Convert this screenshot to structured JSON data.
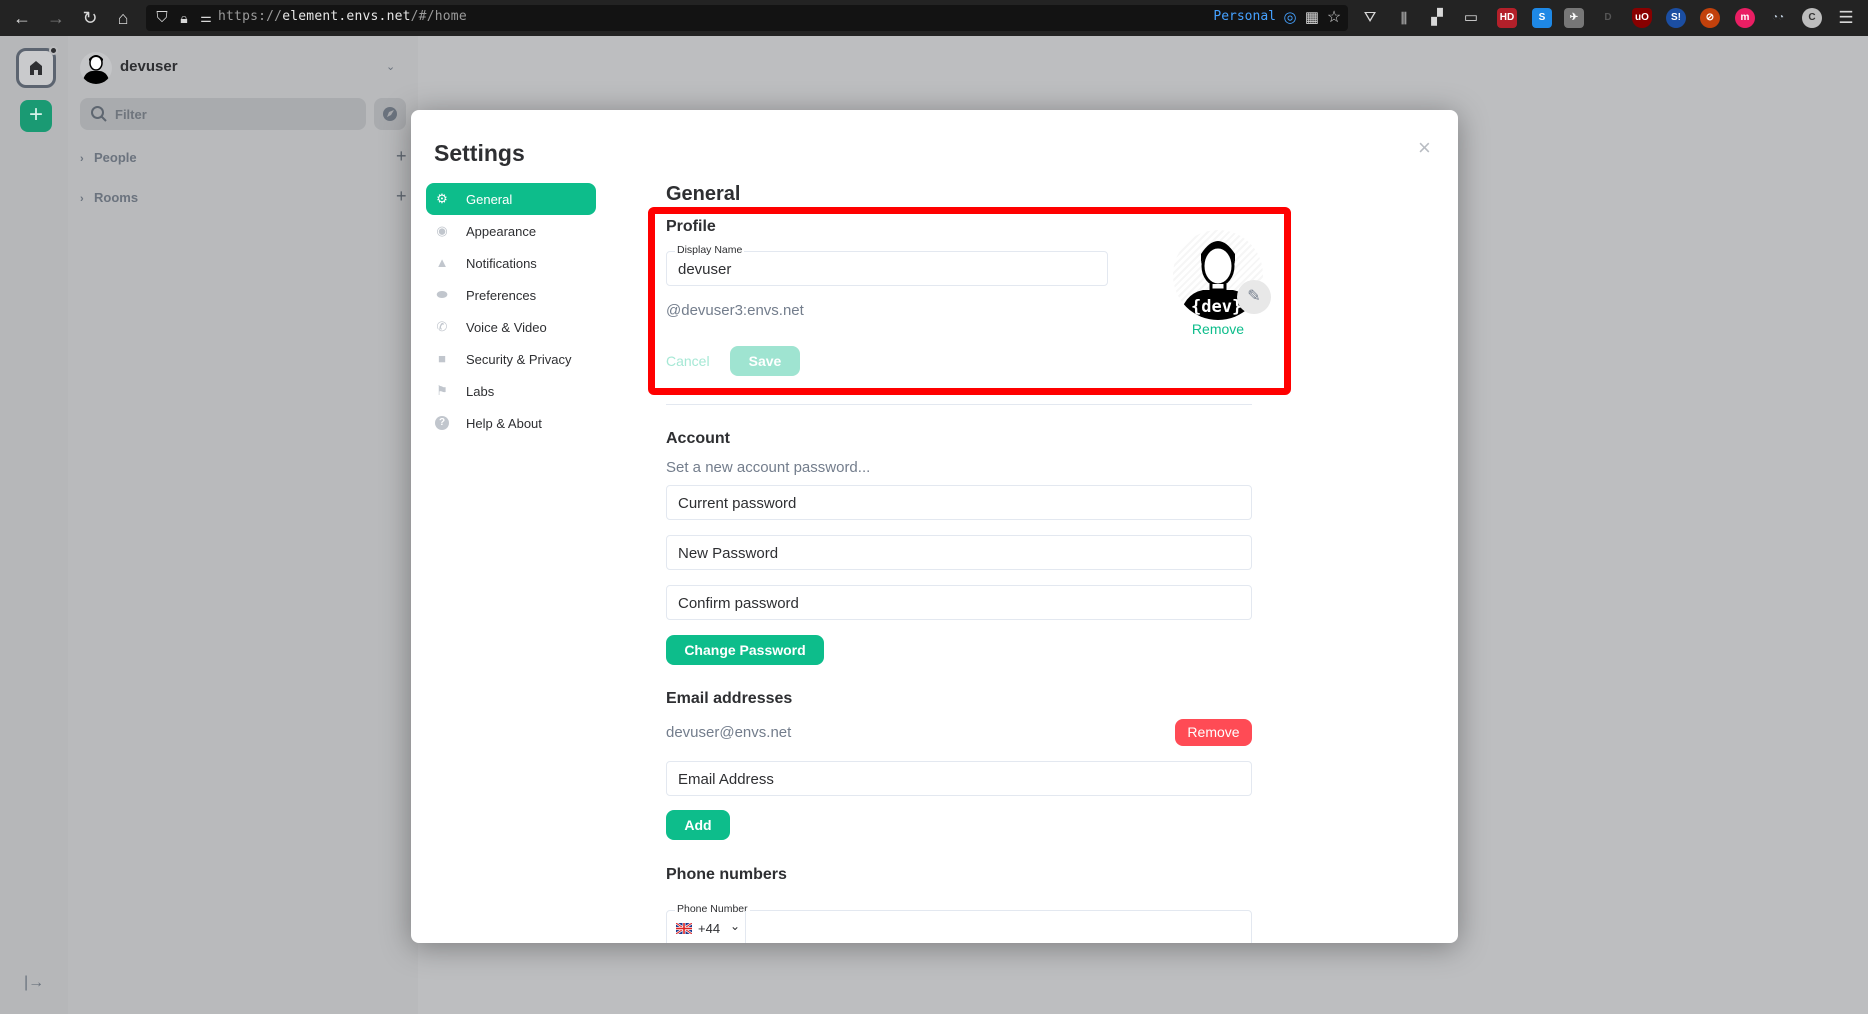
{
  "browser": {
    "url_scheme": "https://",
    "url_host": "element.envs.net",
    "url_path": "/#/home",
    "container_label": "Personal",
    "nav_icons": [
      "back-icon",
      "forward-icon",
      "reload-icon",
      "home-icon"
    ],
    "extensions": [
      "HD",
      "S",
      "uO",
      "S!",
      "m",
      "C"
    ]
  },
  "space_bar": {
    "create_label": "+",
    "expand_label": "|→"
  },
  "room_list": {
    "user_name": "devuser",
    "filter_placeholder": "Filter",
    "sections": [
      {
        "label": "People",
        "add": "+"
      },
      {
        "label": "Rooms",
        "add": "+"
      }
    ]
  },
  "dialog": {
    "title": "Settings",
    "close_label": "×",
    "nav": [
      {
        "label": "General",
        "icon": "gear-icon",
        "glyph": "⚙",
        "active": true
      },
      {
        "label": "Appearance",
        "icon": "eye-icon",
        "glyph": "◉",
        "active": false
      },
      {
        "label": "Notifications",
        "icon": "bell-icon",
        "glyph": "🔔",
        "active": false
      },
      {
        "label": "Preferences",
        "icon": "toggle-icon",
        "glyph": "⬬",
        "active": false
      },
      {
        "label": "Voice & Video",
        "icon": "phone-icon",
        "glyph": "✆",
        "active": false
      },
      {
        "label": "Security & Privacy",
        "icon": "lock-icon",
        "glyph": "🔒",
        "active": false
      },
      {
        "label": "Labs",
        "icon": "flag-icon",
        "glyph": "⚑",
        "active": false
      },
      {
        "label": "Help & About",
        "icon": "help-icon",
        "glyph": "?",
        "active": false
      }
    ],
    "general": {
      "heading": "General",
      "profile": {
        "heading": "Profile",
        "display_name_label": "Display Name",
        "display_name_value": "devuser",
        "user_id": "@devuser3:envs.net",
        "cancel_label": "Cancel",
        "save_label": "Save",
        "avatar_remove_label": "Remove",
        "avatar_edit_glyph": "✎"
      },
      "account": {
        "heading": "Account",
        "subtitle": "Set a new account password...",
        "current_password_placeholder": "Current password",
        "new_password_placeholder": "New Password",
        "confirm_password_placeholder": "Confirm password",
        "change_password_label": "Change Password"
      },
      "email": {
        "heading": "Email addresses",
        "addresses": [
          "devuser@envs.net"
        ],
        "remove_label": "Remove",
        "email_placeholder": "Email Address",
        "add_label": "Add"
      },
      "phone": {
        "heading": "Phone numbers",
        "field_label": "Phone Number",
        "country_code": "+44",
        "country_flag": "GB"
      }
    }
  },
  "colors": {
    "accent": "#0dbd8b",
    "danger": "#ff4b55",
    "highlight": "#ff0000"
  }
}
